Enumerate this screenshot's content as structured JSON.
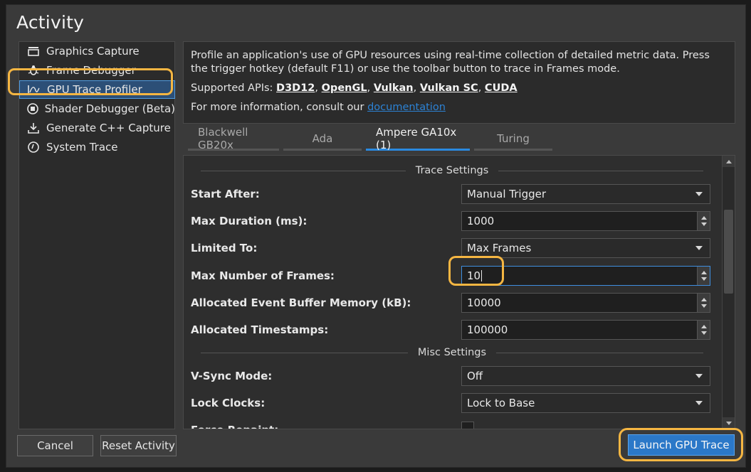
{
  "window": {
    "title": "Activity"
  },
  "sidebar": {
    "items": [
      {
        "label": "Graphics Capture",
        "icon": "camera-icon"
      },
      {
        "label": "Frame Debugger",
        "icon": "bug-icon"
      },
      {
        "label": "GPU Trace Profiler",
        "icon": "trace-chart-icon",
        "selected": true
      },
      {
        "label": "Shader Debugger (Beta)",
        "icon": "shader-icon"
      },
      {
        "label": "Generate C++ Capture",
        "icon": "download-icon"
      },
      {
        "label": "System Trace",
        "icon": "clock-icon"
      }
    ]
  },
  "description": {
    "text": "Profile an application's use of GPU resources using real-time collection of detailed metric data. Press the trigger hotkey (default F11) or use the toolbar button to trace in Frames mode.",
    "apis_label": "Supported APIs:",
    "apis": [
      "D3D12",
      "OpenGL",
      "Vulkan",
      "Vulkan SC",
      "CUDA"
    ],
    "more_info": "For more information, consult our",
    "doc_link": "documentation"
  },
  "tabs": [
    {
      "label": "Blackwell GB20x",
      "active": false
    },
    {
      "label": "Ada",
      "active": false
    },
    {
      "label": "Ampere GA10x (1)",
      "active": true
    },
    {
      "label": "Turing",
      "active": false
    }
  ],
  "trace_settings": {
    "title": "Trace Settings",
    "rows": [
      {
        "label": "Start After:",
        "value": "Manual Trigger",
        "type": "combo"
      },
      {
        "label": "Max Duration (ms):",
        "value": "1000",
        "type": "spin"
      },
      {
        "label": "Limited To:",
        "value": "Max Frames",
        "type": "combo"
      },
      {
        "label": "Max Number of Frames:",
        "value": "10",
        "type": "spin",
        "focused": true
      },
      {
        "label": "Allocated Event Buffer Memory (kB):",
        "value": "10000",
        "type": "spin"
      },
      {
        "label": "Allocated Timestamps:",
        "value": "100000",
        "type": "spin"
      }
    ]
  },
  "misc_settings": {
    "title": "Misc Settings",
    "rows": [
      {
        "label": "V-Sync Mode:",
        "value": "Off",
        "type": "combo"
      },
      {
        "label": "Lock Clocks:",
        "value": "Lock to Base",
        "type": "combo"
      },
      {
        "label": "Force Repaint:",
        "value": "",
        "type": "checkbox"
      }
    ]
  },
  "footer": {
    "cancel": "Cancel",
    "reset": "Reset Activity",
    "launch": "Launch GPU Trace"
  },
  "colors": {
    "accent": "#2b78c8",
    "highlight": "#f5b642",
    "selection": "#2c4f77"
  }
}
